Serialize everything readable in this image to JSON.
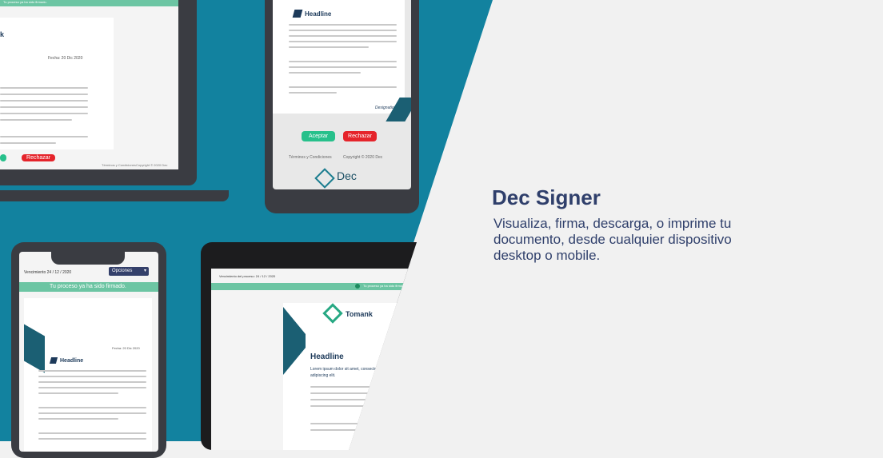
{
  "hero": {
    "title": "Dec Signer",
    "description": "Visualiza, firma, descarga, o imprime tu documento, desde cualquier dispositivo desktop o mobile."
  },
  "laptop_top": {
    "status_bar": "Tu proceso ya ha sido firmado.",
    "date": "Fecha: 20 Dic 2020",
    "reject_button": "Rechazar",
    "footer_terms": "Términos y Condiciones",
    "footer_copyright": "Copyright © 2020 Dec"
  },
  "tablet_top": {
    "headline": "Headline",
    "designation": "Designation",
    "accept_button": "Aceptar",
    "reject_button": "Rechazar",
    "footer_terms": "Términos y Condiciones",
    "footer_copyright": "Copyright © 2020 Dec",
    "logo_text": "Dec"
  },
  "phone_bottom": {
    "expiry": "Vencimiento 24 / 12 / 2020",
    "options_label": "Opciones",
    "status_bar": "Tu proceso ya ha sido firmado.",
    "date": "Fecha: 20 Dic 2020",
    "headline": "Headline"
  },
  "monitor_bottom": {
    "process_label": "Vencimiento del proceso: 24 / 12 / 2020",
    "status_bar": "Tu proceso ya ha sido firmado.",
    "brand": "Tomank",
    "headline": "Headline",
    "lorem": "Lorem ipsum dolor sit amet, consectetur adipiscing elit."
  }
}
